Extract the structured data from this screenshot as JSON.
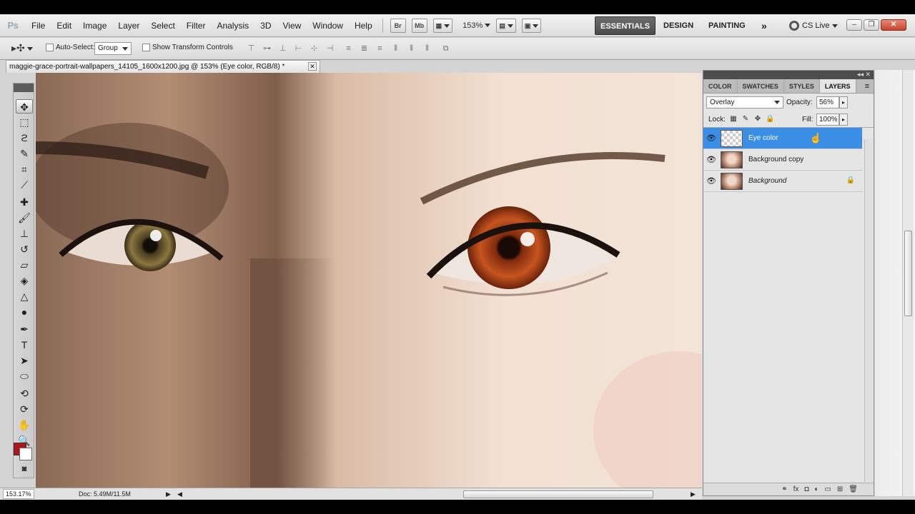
{
  "app": {
    "logo": "Ps"
  },
  "menu": [
    "File",
    "Edit",
    "Image",
    "Layer",
    "Select",
    "Filter",
    "Analysis",
    "3D",
    "View",
    "Window",
    "Help"
  ],
  "appbar": {
    "bridge": "Br",
    "minibridge": "Mb",
    "zoom": "153%"
  },
  "workspaces": {
    "essentials": "ESSENTIALS",
    "design": "DESIGN",
    "painting": "PAINTING",
    "more": "»"
  },
  "cslive": "CS Live",
  "options": {
    "auto_select_label": "Auto-Select:",
    "auto_select_value": "Group",
    "transform_label": "Show Transform Controls"
  },
  "document": {
    "tab_title": "maggie-grace-portrait-wallpapers_14105_1600x1200.jpg @ 153% (Eye color, RGB/8) *"
  },
  "colors": {
    "foreground": "#b0151a",
    "background": "#ffffff",
    "selection": "#3a8ee6"
  },
  "status": {
    "zoom": "153.17%",
    "doc_size": "Doc: 5.49M/11.5M"
  },
  "panel": {
    "tabs": [
      "COLOR",
      "SWATCHES",
      "STYLES",
      "LAYERS"
    ],
    "blend_mode": "Overlay",
    "opacity_label": "Opacity:",
    "opacity": "56%",
    "lock_label": "Lock:",
    "fill_label": "Fill:",
    "fill": "100%",
    "layers": [
      {
        "name": "Eye color",
        "visible": true,
        "selected": true,
        "locked": false
      },
      {
        "name": "Background copy",
        "visible": true,
        "selected": false,
        "locked": false
      },
      {
        "name": "Background",
        "visible": true,
        "selected": false,
        "locked": true
      }
    ]
  }
}
